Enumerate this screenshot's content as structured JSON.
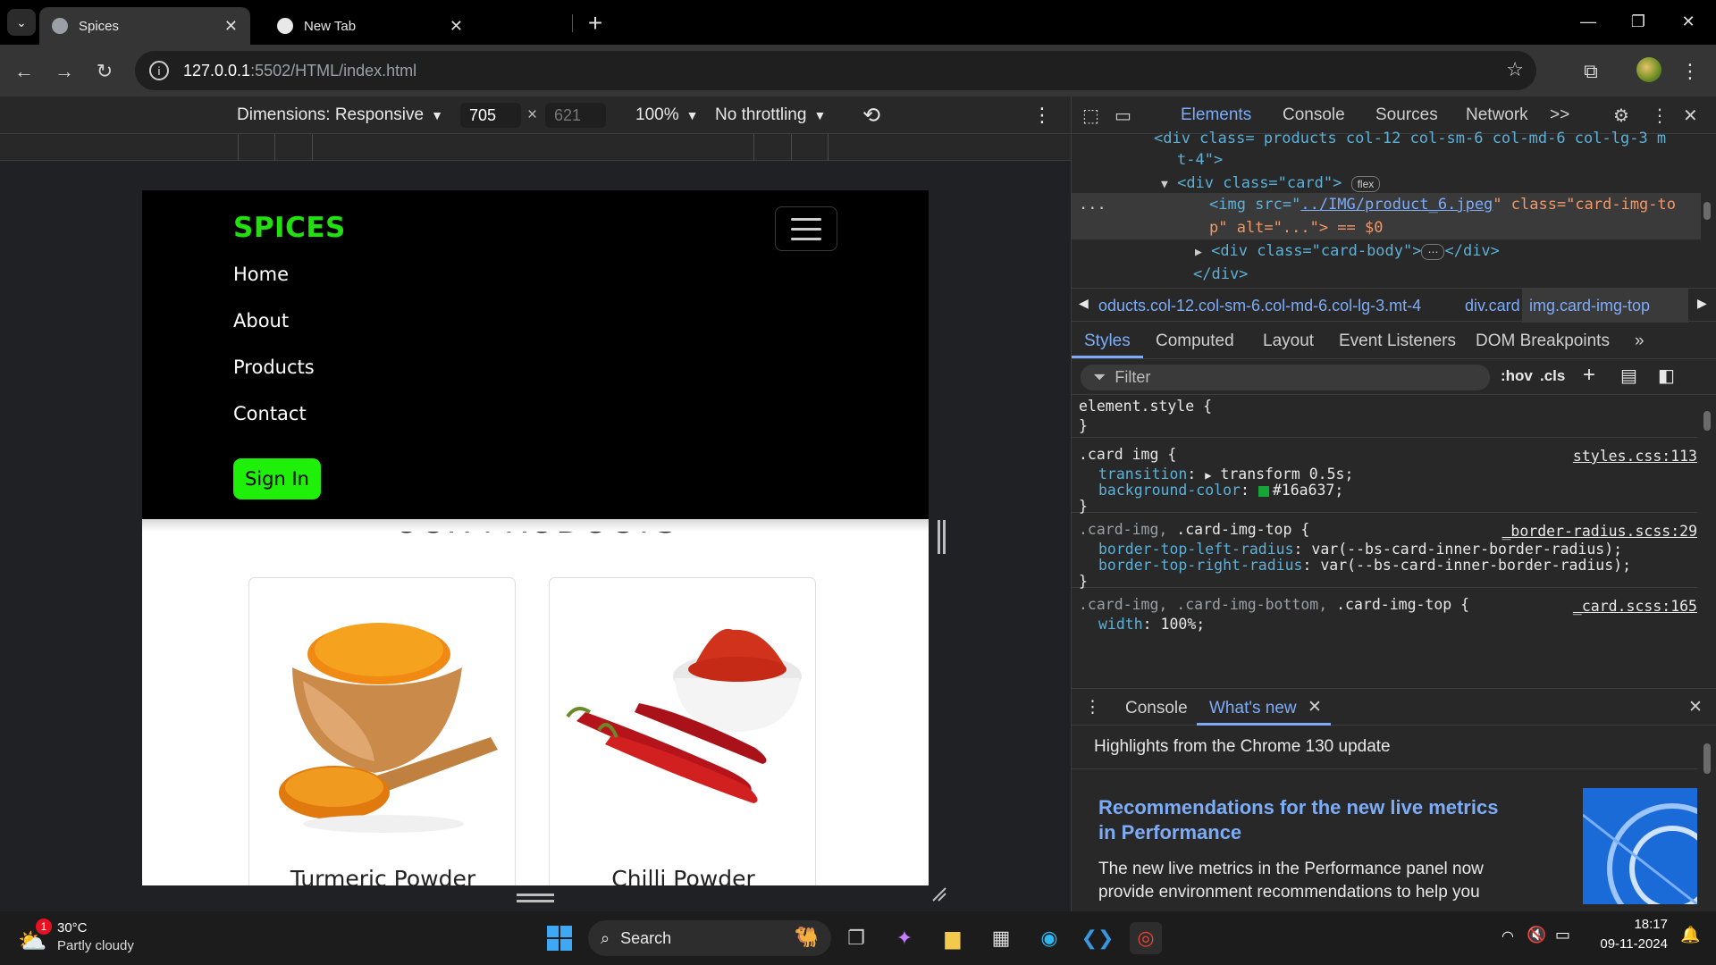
{
  "browser": {
    "tabs": [
      {
        "title": "Spices",
        "active": true
      },
      {
        "title": "New Tab",
        "active": false
      }
    ],
    "new_tab_symbol": "+",
    "url_host": "127.0.0.1",
    "url_path": ":5502/HTML/index.html"
  },
  "device_toolbar": {
    "dimensions_label": "Dimensions: Responsive",
    "width": "705",
    "height": "621",
    "zoom": "100%",
    "throttling": "No throttling"
  },
  "site": {
    "brand": "SPICES",
    "nav_links": [
      "Home",
      "About",
      "Products",
      "Contact"
    ],
    "signin_label": "Sign In",
    "section_title": "OUR PRODUCTS",
    "products": [
      {
        "name": "Turmeric Powder",
        "icon": "turmeric-bowl-image"
      },
      {
        "name": "Chilli Powder",
        "icon": "chilli-bowl-image"
      }
    ],
    "colors": {
      "brand_green": "#22e00f",
      "signin_bg": "#1ef00a"
    }
  },
  "devtools": {
    "tabs": [
      "Elements",
      "Console",
      "Sources",
      "Network"
    ],
    "more_tabs": ">>",
    "dom": {
      "line1": "<div class= products col-12 col-sm-6 col-md-6 col-lg-3 m",
      "line1b": "t-4\">",
      "line2_tag": "<div class=\"card\">",
      "line2_pill": "flex",
      "line3_src_label": "<img src=\"",
      "line3_src": "../IMG/product_6.jpeg",
      "line3_class": "\" class=\"card-img-to",
      "line3b": "p\" alt=\"...\"> == $0",
      "line4": "<div class=\"card-body\">",
      "line4_end": "</div>",
      "line5": "</div>",
      "dots": "..."
    },
    "breadcrumbs": [
      "oducts.col-12.col-sm-6.col-md-6.col-lg-3.mt-4",
      "div.card",
      "img.card-img-top"
    ],
    "subtabs": [
      "Styles",
      "Computed",
      "Layout",
      "Event Listeners",
      "DOM Breakpoints"
    ],
    "filter_placeholder": "Filter",
    "filter_tools": [
      ":hov",
      ".cls"
    ],
    "styles": {
      "element_style": "element.style {",
      "close": "}",
      "rule1_selector": ".card img {",
      "rule1_source": "styles.css:113",
      "rule1_p1_name": "transition",
      "rule1_p1_value": "transform 0.5s;",
      "rule1_p2_name": "background-color",
      "rule1_p2_value": "#16a637;",
      "rule2_selector_dim": ".card-img, ",
      "rule2_selector": ".card-img-top {",
      "rule2_source": "_border-radius.scss:29",
      "rule2_p1": "border-top-left-radius",
      "rule2_p1_value": "var(--bs-card-inner-border-radius);",
      "rule2_p2": "border-top-right-radius",
      "rule2_p2_value": "var(--bs-card-inner-border-radius);",
      "rule3_selector_dim": ".card-img, .card-img-bottom, ",
      "rule3_selector": ".card-img-top {",
      "rule3_source": "_card.scss:165",
      "rule3_p1": "width",
      "rule3_p1_value": "100%;",
      "swatch_color": "#16a637"
    },
    "drawer_tabs": [
      "Console",
      "What's new"
    ],
    "whats_new": {
      "heading": "Highlights from the Chrome 130 update",
      "title": "Recommendations for the new live metrics in Performance",
      "body": "The new live metrics in the Performance panel now provide environment recommendations to help you"
    }
  },
  "taskbar": {
    "weather_temp": "30°C",
    "weather_desc": "Partly cloudy",
    "weather_badge": "1",
    "search_label": "Search",
    "time": "18:17",
    "date": "09-11-2024"
  }
}
